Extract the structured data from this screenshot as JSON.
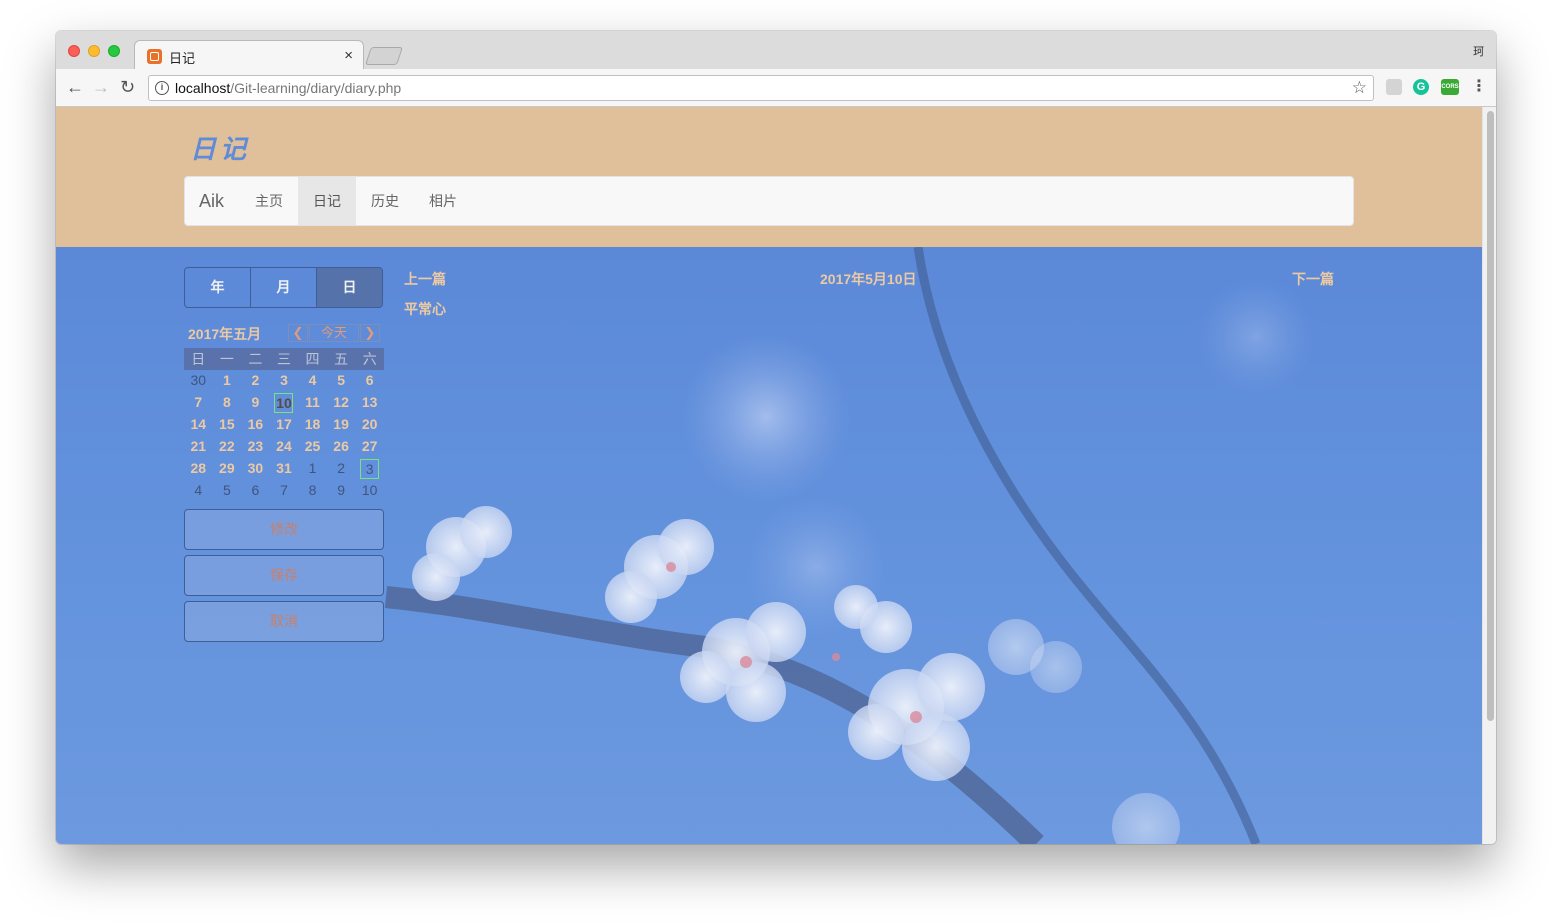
{
  "browser": {
    "tab_title": "日记",
    "tab_close": "×",
    "profile_label": "珂",
    "url_host": "localhost",
    "url_path": "/Git-learning/diary/diary.php",
    "ext_g_label": "G",
    "ext_cors_label": "CORS"
  },
  "header": {
    "site_title": "日记",
    "brand": "Aik",
    "nav": [
      {
        "label": "主页",
        "active": false
      },
      {
        "label": "日记",
        "active": true
      },
      {
        "label": "历史",
        "active": false
      },
      {
        "label": "相片",
        "active": false
      }
    ]
  },
  "sidebar": {
    "view_buttons": [
      "年",
      "月",
      "日"
    ],
    "calendar": {
      "month_label": "2017年五月",
      "prev": "❮",
      "today": "今天",
      "next": "❯",
      "weekdays": [
        "日",
        "一",
        "二",
        "三",
        "四",
        "五",
        "六"
      ],
      "weeks": [
        [
          "30",
          "1",
          "2",
          "3",
          "4",
          "5",
          "6"
        ],
        [
          "7",
          "8",
          "9",
          "10",
          "11",
          "12",
          "13"
        ],
        [
          "14",
          "15",
          "16",
          "17",
          "18",
          "19",
          "20"
        ],
        [
          "21",
          "22",
          "23",
          "24",
          "25",
          "26",
          "27"
        ],
        [
          "28",
          "29",
          "30",
          "31",
          "1",
          "2",
          "3"
        ],
        [
          "4",
          "5",
          "6",
          "7",
          "8",
          "9",
          "10"
        ]
      ]
    },
    "actions": [
      "修改",
      "保存",
      "取消"
    ]
  },
  "entry": {
    "prev_label": "上一篇",
    "date": "2017年5月10日",
    "next_label": "下一篇",
    "title": "平常心"
  }
}
